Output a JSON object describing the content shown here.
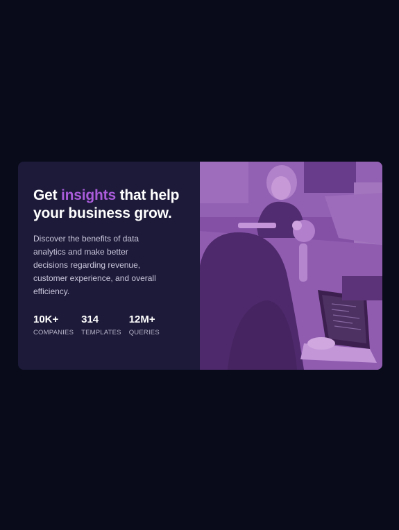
{
  "card": {
    "headline": {
      "before": "Get ",
      "accent": "insights",
      "after": " that help your business grow."
    },
    "description": "Discover the benefits of data analytics and make better decisions regarding revenue, customer experience, and overall efficiency.",
    "stats": [
      {
        "value": "10K+",
        "label": "COMPANIES"
      },
      {
        "value": "314",
        "label": "TEMPLATES"
      },
      {
        "value": "12M+",
        "label": "QUERIES"
      }
    ],
    "image": {
      "alt": "People working at laptops in an office",
      "overlay_color": "#aa5cdb"
    }
  },
  "colors": {
    "page_background": "#090b1a",
    "card_background": "#1c1a38",
    "accent": "#aa5cdb",
    "heading": "#ffffff",
    "body_text": "#cac6dd"
  }
}
